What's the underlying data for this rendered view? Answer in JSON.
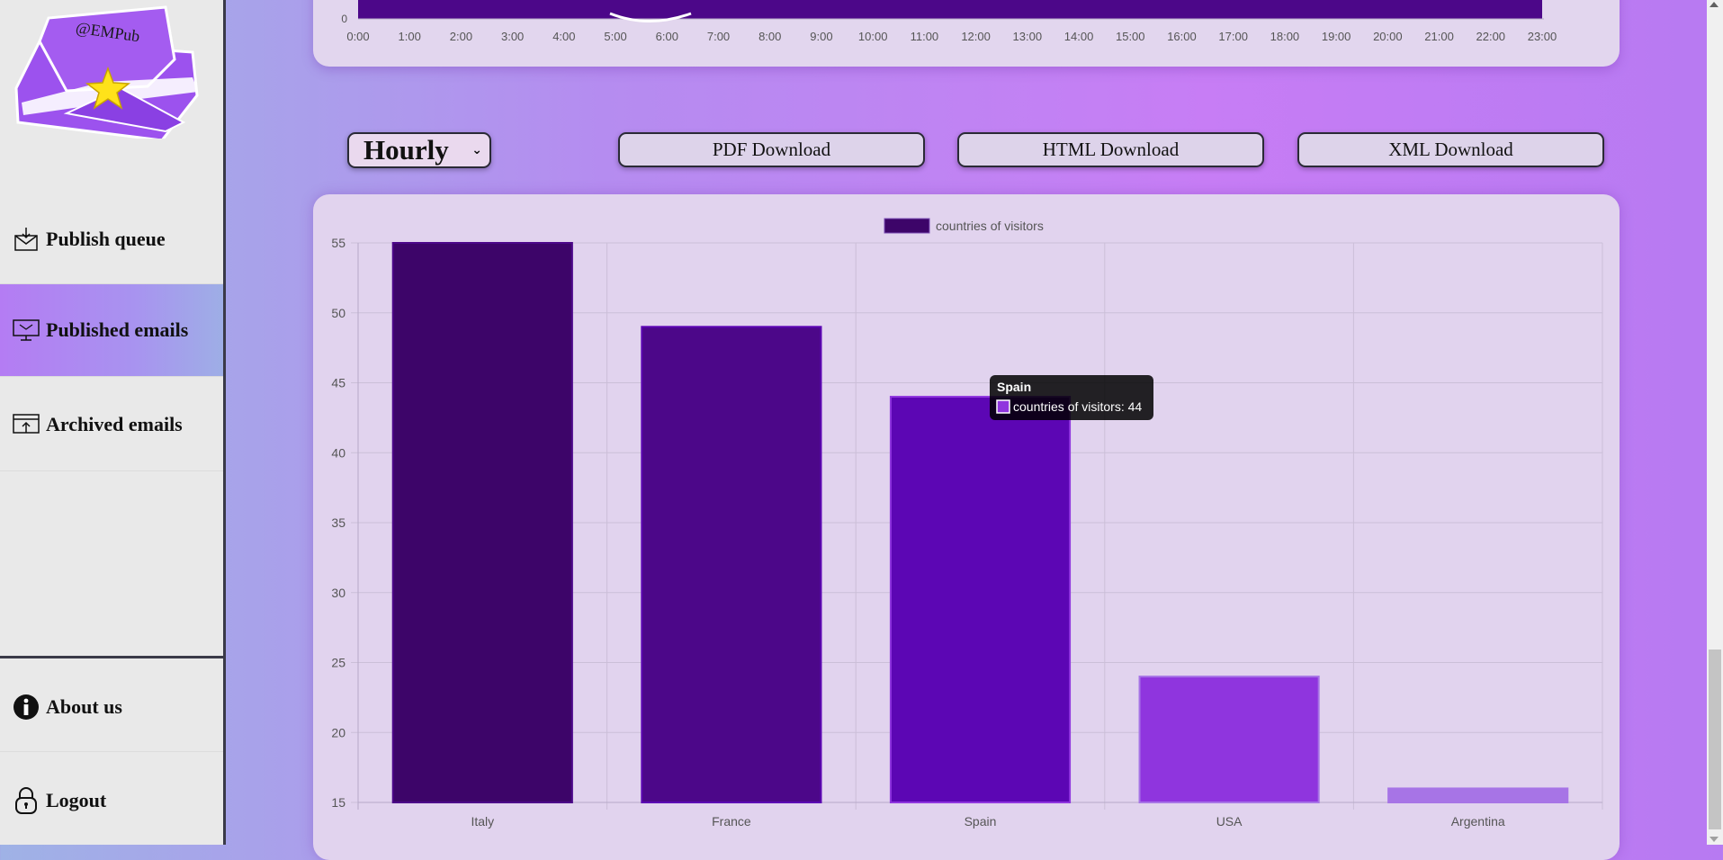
{
  "sidebar": {
    "logo_text": "@EMPub",
    "items": [
      {
        "label": "Publish queue",
        "icon": "inbox-download-icon"
      },
      {
        "label": "Published emails",
        "icon": "monitor-mail-icon",
        "active": true
      },
      {
        "label": "Archived emails",
        "icon": "archive-upload-icon"
      },
      {
        "label": "About us",
        "icon": "info-icon"
      },
      {
        "label": "Logout",
        "icon": "lock-icon"
      }
    ]
  },
  "top_chart": {
    "y_tick": "0",
    "x_ticks": [
      "0:00",
      "1:00",
      "2:00",
      "3:00",
      "4:00",
      "5:00",
      "6:00",
      "7:00",
      "8:00",
      "9:00",
      "10:00",
      "11:00",
      "12:00",
      "13:00",
      "14:00",
      "15:00",
      "16:00",
      "17:00",
      "18:00",
      "19:00",
      "20:00",
      "21:00",
      "22:00",
      "23:00"
    ]
  },
  "controls": {
    "period_select": "Hourly",
    "pdf_label": "PDF Download",
    "html_label": "HTML Download",
    "xml_label": "XML Download"
  },
  "chart_data": {
    "type": "bar",
    "categories": [
      "Italy",
      "France",
      "Spain",
      "USA",
      "Argentina"
    ],
    "series": [
      {
        "name": "countries of visitors",
        "values": [
          55,
          49,
          44,
          24,
          16
        ]
      }
    ],
    "ylim": [
      15,
      55
    ],
    "yticks": [
      15,
      20,
      25,
      30,
      35,
      40,
      45,
      50,
      55
    ],
    "bar_colors": [
      "#3d0569",
      "#4c0789",
      "#5c06b4",
      "#8f35de",
      "#a774e6"
    ],
    "grid": true,
    "legend": "top-center",
    "tooltip": {
      "title": "Spain",
      "text": "countries of visitors: 44",
      "swatch": "#8f35de"
    }
  }
}
